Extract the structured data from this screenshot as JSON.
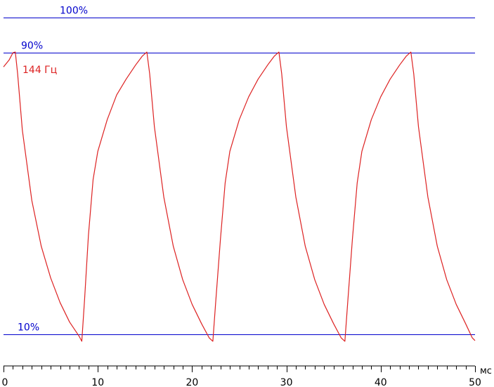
{
  "chart_data": {
    "type": "line",
    "title": "",
    "xlabel": "мс",
    "ylabel": "",
    "xlim": [
      0,
      50
    ],
    "ylim": [
      -5,
      105
    ],
    "x_ticks": [
      0,
      10,
      20,
      30,
      40,
      50
    ],
    "x_minor_step": 1,
    "grid": false,
    "reference_lines": [
      {
        "label": "100%",
        "y": 100,
        "color": "#0000cc"
      },
      {
        "label": "90%",
        "y": 90,
        "color": "#0000cc"
      },
      {
        "label": "10%",
        "y": 10,
        "color": "#0000cc"
      }
    ],
    "series": [
      {
        "name": "144 Гц",
        "color": "#dd2222",
        "x": [
          0,
          0.6,
          1.0,
          1.25,
          1.5,
          2,
          3,
          4,
          5,
          6,
          7,
          8,
          8.3,
          8.6,
          9,
          9.5,
          10,
          11,
          12,
          13,
          14,
          14.7,
          15.2,
          15.5,
          16,
          17,
          18,
          19,
          20,
          21,
          21.8,
          22.2,
          22.5,
          23,
          23.5,
          24,
          25,
          26,
          27,
          28,
          28.7,
          29.2,
          29.5,
          30,
          31,
          32,
          33,
          34,
          35,
          35.8,
          36.2,
          36.5,
          37,
          37.5,
          38,
          39,
          40,
          41,
          42,
          42.7,
          43.2,
          43.5,
          44,
          45,
          46,
          47,
          48,
          49,
          49.7,
          50
        ],
        "y": [
          86,
          88,
          90,
          90.2,
          84,
          68,
          48,
          35,
          26,
          19,
          13.5,
          9.5,
          8,
          20,
          38,
          54,
          62,
          71,
          78,
          82.5,
          86.5,
          89,
          90.2,
          84,
          69,
          49,
          35,
          25.5,
          18.5,
          13,
          9,
          8,
          19,
          37,
          53,
          62,
          71,
          77.5,
          82.5,
          86.5,
          89,
          90.2,
          84,
          69,
          49,
          35,
          25.5,
          18.5,
          13,
          9,
          8,
          19,
          37,
          53,
          62,
          71,
          77.5,
          82.5,
          86.5,
          89,
          90.2,
          84,
          69,
          49,
          35,
          25.5,
          18.5,
          13,
          9,
          8.2
        ]
      }
    ]
  }
}
